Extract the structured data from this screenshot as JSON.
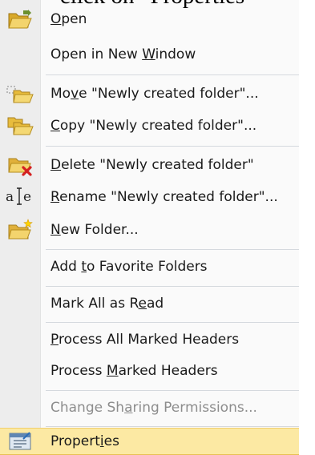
{
  "caption": "click on “Properties”",
  "menu": {
    "items": [
      {
        "key": "open",
        "pre": "",
        "u": "O",
        "post": "pen",
        "icon": "open-folder-icon",
        "disabled": false
      },
      {
        "key": "open-new-window",
        "pre": "Open in New ",
        "u": "W",
        "post": "indow",
        "icon": "",
        "disabled": false
      },
      {
        "key": "move",
        "pre": "Mo",
        "u": "v",
        "post": "e \"Newly created folder\"...",
        "icon": "move-folder-icon",
        "disabled": false
      },
      {
        "key": "copy",
        "pre": "",
        "u": "C",
        "post": "opy \"Newly created folder\"...",
        "icon": "copy-folder-icon",
        "disabled": false
      },
      {
        "key": "delete",
        "pre": "",
        "u": "D",
        "post": "elete \"Newly created folder\"",
        "icon": "delete-folder-icon",
        "disabled": false
      },
      {
        "key": "rename",
        "pre": "",
        "u": "R",
        "post": "ename \"Newly created folder\"...",
        "icon": "rename-icon",
        "disabled": false
      },
      {
        "key": "new-folder",
        "pre": "",
        "u": "N",
        "post": "ew Folder...",
        "icon": "new-folder-icon",
        "disabled": false
      },
      {
        "key": "add-favorites",
        "pre": "Add ",
        "u": "t",
        "post": "o Favorite Folders",
        "icon": "",
        "disabled": false
      },
      {
        "key": "mark-all-read",
        "pre": "Mark All as R",
        "u": "e",
        "post": "ad",
        "icon": "",
        "disabled": false
      },
      {
        "key": "process-all-marked",
        "pre": "",
        "u": "P",
        "post": "rocess All Marked Headers",
        "icon": "",
        "disabled": false
      },
      {
        "key": "process-marked",
        "pre": "Process ",
        "u": "M",
        "post": "arked Headers",
        "icon": "",
        "disabled": false
      },
      {
        "key": "change-sharing",
        "pre": "Change Sh",
        "u": "a",
        "post": "ring Permissions...",
        "icon": "",
        "disabled": true
      },
      {
        "key": "properties",
        "pre": "Propert",
        "u": "i",
        "post": "es",
        "icon": "properties-icon",
        "disabled": false
      }
    ]
  }
}
